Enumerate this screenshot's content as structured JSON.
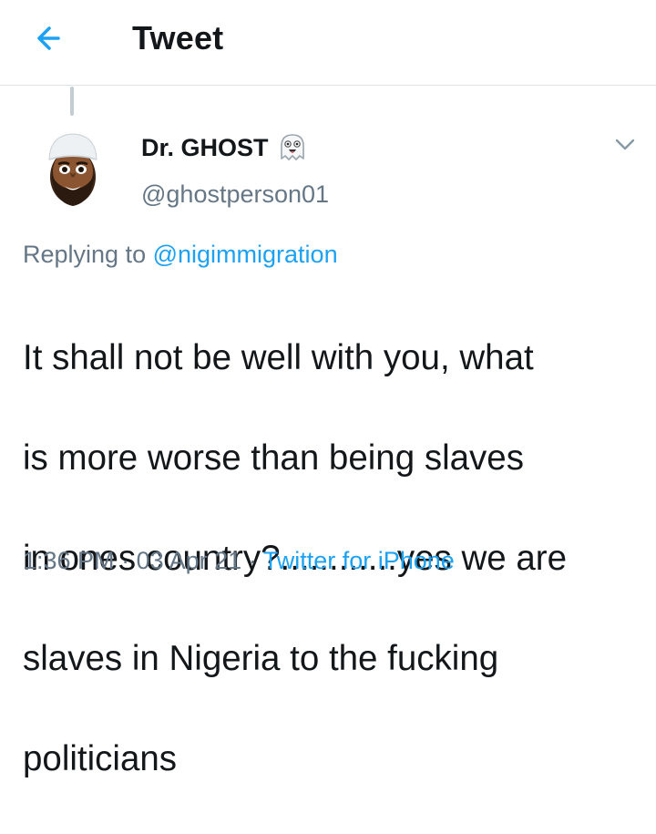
{
  "header": {
    "title": "Tweet",
    "back_icon": "arrow-left-icon",
    "accent": "#1da1f2"
  },
  "tweet": {
    "author_name": "Dr. GHOST",
    "author_emoji": "ghost-icon",
    "author_handle": "@ghostperson01",
    "replying_prefix": "Replying to",
    "replying_to": "@nigimmigration",
    "text_lines": [
      "It shall not be well with you, what",
      "is more worse than being slaves",
      "in ones country?............yes we are",
      "slaves in Nigeria to the fucking",
      "politicians"
    ],
    "time": "1:36 PM",
    "date": "03 Apr 21",
    "separator": "·",
    "source": "Twitter for iPhone"
  },
  "colors": {
    "text": "#14171a",
    "secondary": "#657786",
    "link": "#1da1f2",
    "divider": "#dfe3e6"
  }
}
